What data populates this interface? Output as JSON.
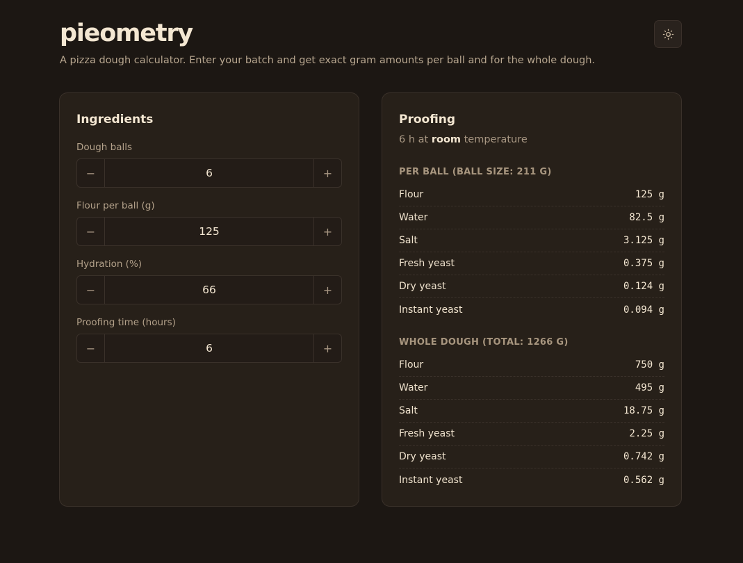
{
  "app": {
    "title": "pieometry",
    "subtitle": "A pizza dough calculator. Enter your batch and get exact gram amounts per ball and for the whole dough."
  },
  "theme_toggle": {
    "icon": "sun-icon"
  },
  "ingredients": {
    "title": "Ingredients",
    "fields": [
      {
        "label": "Dough balls",
        "value": "6",
        "minus": "−",
        "plus": "+"
      },
      {
        "label": "Flour per ball (g)",
        "value": "125",
        "minus": "−",
        "plus": "+"
      },
      {
        "label": "Hydration (%)",
        "value": "66",
        "minus": "−",
        "plus": "+"
      },
      {
        "label": "Proofing time (hours)",
        "value": "6",
        "minus": "−",
        "plus": "+"
      }
    ]
  },
  "proofing": {
    "title": "Proofing",
    "sub_prefix": "6 h at",
    "sub_strong": "room",
    "sub_suffix": "temperature",
    "per_ball": {
      "heading": "PER BALL (BALL SIZE: 211 G)",
      "rows": [
        {
          "name": "Flour",
          "amount": "125 g"
        },
        {
          "name": "Water",
          "amount": "82.5 g"
        },
        {
          "name": "Salt",
          "amount": "3.125 g"
        },
        {
          "name": "Fresh yeast",
          "amount": "0.375 g"
        },
        {
          "name": "Dry yeast",
          "amount": "0.124 g"
        },
        {
          "name": "Instant yeast",
          "amount": "0.094 g"
        }
      ]
    },
    "whole_dough": {
      "heading": "WHOLE DOUGH (TOTAL: 1266 G)",
      "rows": [
        {
          "name": "Flour",
          "amount": "750 g"
        },
        {
          "name": "Water",
          "amount": "495 g"
        },
        {
          "name": "Salt",
          "amount": "18.75 g"
        },
        {
          "name": "Fresh yeast",
          "amount": "2.25 g"
        },
        {
          "name": "Dry yeast",
          "amount": "0.742 g"
        },
        {
          "name": "Instant yeast",
          "amount": "0.562 g"
        }
      ]
    }
  }
}
